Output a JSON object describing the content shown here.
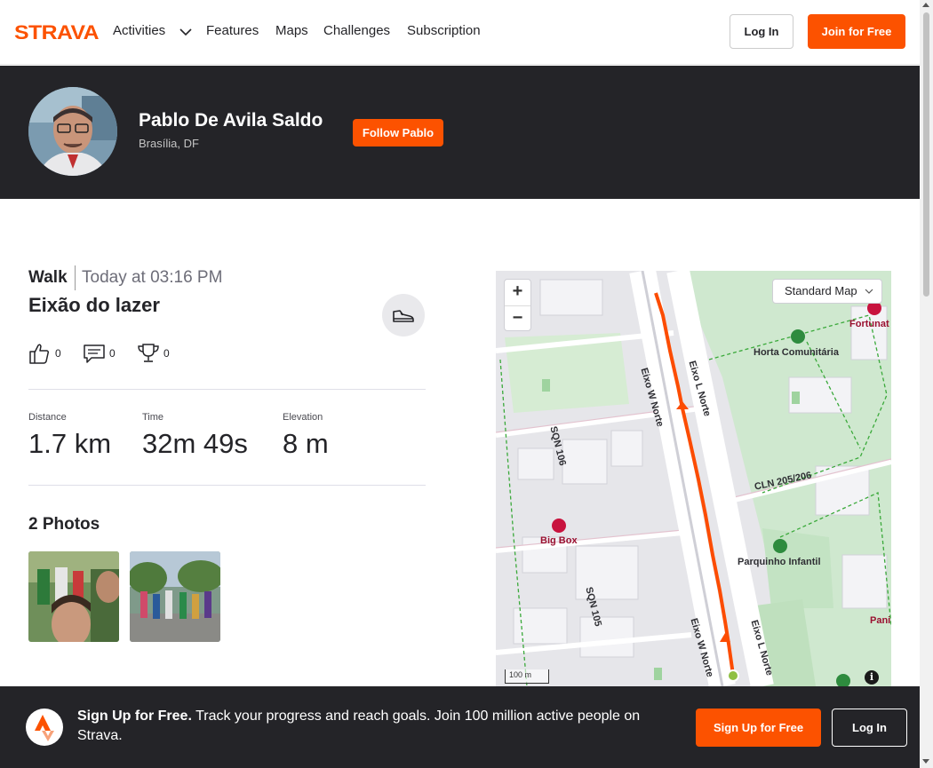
{
  "nav": {
    "brand": "STRAVA",
    "items": [
      "Activities",
      "Features",
      "Maps",
      "Challenges",
      "Subscription"
    ],
    "login": "Log In",
    "join": "Join for Free"
  },
  "athlete": {
    "name": "Pablo De Avila Saldo",
    "location": "Brasília, DF",
    "follow": "Follow Pablo"
  },
  "activity": {
    "type": "Walk",
    "time": "Today at 03:16 PM",
    "title": "Eixão do lazer",
    "kudos": "0",
    "comments": "0",
    "achievements": "0",
    "stats": [
      {
        "label": "Distance",
        "value": "1.7 km"
      },
      {
        "label": "Time",
        "value": "32m 49s"
      },
      {
        "label": "Elevation",
        "value": "8 m"
      }
    ],
    "photos_heading": "2 Photos"
  },
  "map": {
    "style": "Standard Map",
    "zoom_in": "+",
    "zoom_out": "−",
    "scale": "100 m",
    "info": "i",
    "labels": [
      "Eixo L Norte",
      "Eixo W Norte",
      "SQN 106",
      "Horta Comunitária",
      "Fortunat",
      "CLN 205/206",
      "Big Box",
      "Parquinho Infantil",
      "SQN 105",
      "Eixo W Norte",
      "Eixo L Norte",
      "Pani"
    ]
  },
  "banner": {
    "bold": "Sign Up for Free.",
    "text": " Track your progress and reach goals. Join 100 million active people on Strava.",
    "signup": "Sign Up for Free",
    "login": "Log In"
  },
  "colors": {
    "brand": "#fc5200",
    "dark": "#242428",
    "route": "#fc4c02"
  }
}
